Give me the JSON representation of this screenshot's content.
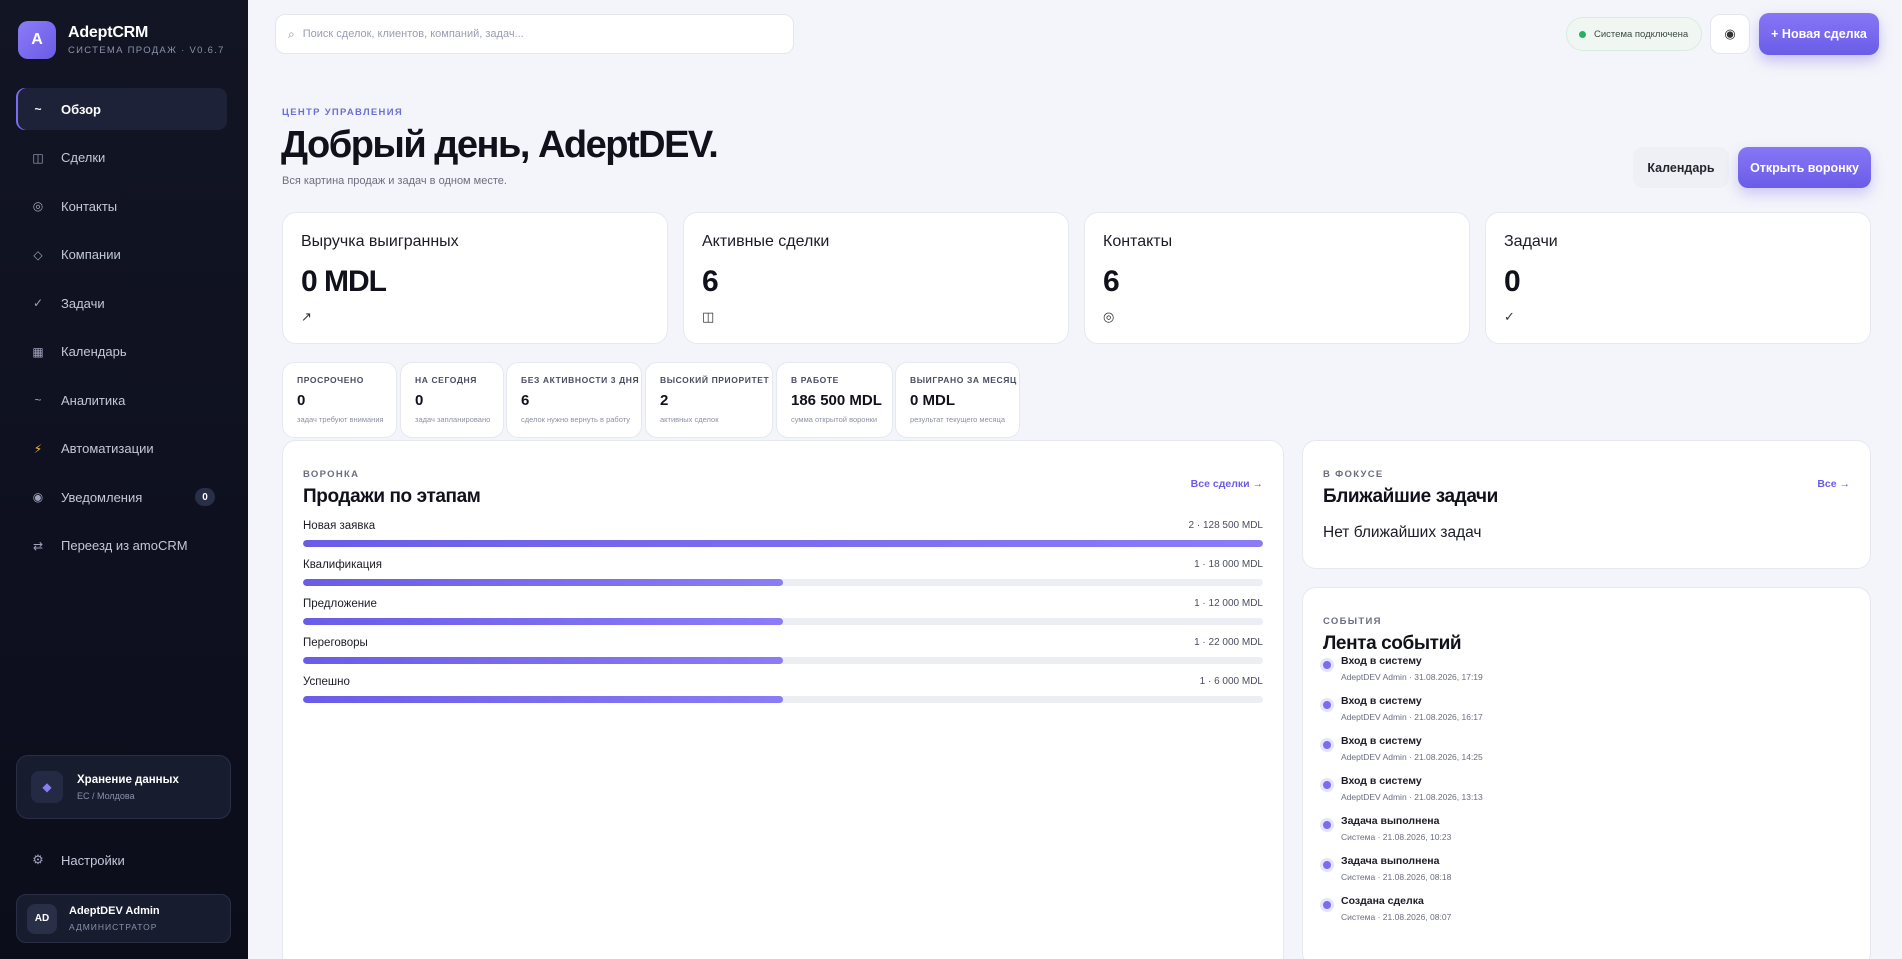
{
  "brand": {
    "logo": "A",
    "name": "AdeptCRM",
    "subtitle": "СИСТЕМА ПРОДАЖ · V0.6.7"
  },
  "nav": [
    {
      "label": "Обзор",
      "icon": "~",
      "active": true
    },
    {
      "label": "Сделки",
      "icon": "◫"
    },
    {
      "label": "Контакты",
      "icon": "◎"
    },
    {
      "label": "Компании",
      "icon": "◇"
    },
    {
      "label": "Задачи",
      "icon": "✓"
    },
    {
      "label": "Календарь",
      "icon": "▦"
    },
    {
      "label": "Аналитика",
      "icon": "~"
    },
    {
      "label": "Автоматизации",
      "icon": "⚡"
    },
    {
      "label": "Уведомления",
      "icon": "◉",
      "badge": "0"
    },
    {
      "label": "Переезд из amoCRM",
      "icon": "⇄"
    }
  ],
  "storage": {
    "icon": "◆",
    "title": "Хранение данных",
    "subtitle": "ЕС / Молдова"
  },
  "settings": {
    "icon": "⚙",
    "label": "Настройки"
  },
  "user": {
    "initials": "AD",
    "name": "AdeptDEV Admin",
    "role": "АДМИНИСТРАТОР"
  },
  "topbar": {
    "search_icon": "⌕",
    "search_placeholder": "Поиск сделок, клиентов, компаний, задач...",
    "status": "Система подключена",
    "theme_icon": "◉",
    "new_deal": "+ Новая сделка"
  },
  "header": {
    "eyebrow": "ЦЕНТР УПРАВЛЕНИЯ",
    "title": "Добрый день, AdeptDEV.",
    "subtitle": "Вся картина продаж и задач в одном месте.",
    "calendar_btn": "Календарь",
    "funnel_btn": "Открыть воронку"
  },
  "kpis": [
    {
      "label": "Выручка выигранных",
      "value": "0 MDL",
      "icon": "↗"
    },
    {
      "label": "Активные сделки",
      "value": "6",
      "icon": "◫"
    },
    {
      "label": "Контакты",
      "value": "6",
      "icon": "◎"
    },
    {
      "label": "Задачи",
      "value": "0",
      "icon": "✓"
    }
  ],
  "mini_stats": [
    {
      "label": "ПРОСРОЧЕНО",
      "value": "0",
      "sub": "задач требуют внимания"
    },
    {
      "label": "НА СЕГОДНЯ",
      "value": "0",
      "sub": "задач запланировано"
    },
    {
      "label": "БЕЗ АКТИВНОСТИ 3 ДНЯ",
      "value": "6",
      "sub": "сделок нужно вернуть в работу"
    },
    {
      "label": "ВЫСОКИЙ ПРИОРИТЕТ",
      "value": "2",
      "sub": "активных сделок"
    },
    {
      "label": "В РАБОТЕ",
      "value": "186 500 MDL",
      "sub": "сумма открытой воронки"
    },
    {
      "label": "ВЫИГРАНО ЗА МЕСЯЦ",
      "value": "0 MDL",
      "sub": "результат текущего месяца"
    }
  ],
  "funnel": {
    "eyebrow": "ВОРОНКА",
    "title": "Продажи по этапам",
    "link": "Все сделки →",
    "stages": [
      {
        "name": "Новая заявка",
        "meta": "2 · 128 500 MDL",
        "fraction": 1.0
      },
      {
        "name": "Квалификация",
        "meta": "1 · 18 000 MDL",
        "fraction": 0.5
      },
      {
        "name": "Предложение",
        "meta": "1 · 12 000 MDL",
        "fraction": 0.5
      },
      {
        "name": "Переговоры",
        "meta": "1 · 22 000 MDL",
        "fraction": 0.5
      },
      {
        "name": "Успешно",
        "meta": "1 · 6 000 MDL",
        "fraction": 0.5
      }
    ]
  },
  "tasks": {
    "eyebrow": "В ФОКУСЕ",
    "title": "Ближайшие задачи",
    "link": "Все →",
    "empty": "Нет ближайших задач"
  },
  "events": {
    "eyebrow": "СОБЫТИЯ",
    "title": "Лента событий",
    "items": [
      {
        "title": "Вход в систему",
        "meta": "AdeptDEV Admin · 31.08.2026, 17:19"
      },
      {
        "title": "Вход в систему",
        "meta": "AdeptDEV Admin · 21.08.2026, 16:17"
      },
      {
        "title": "Вход в систему",
        "meta": "AdeptDEV Admin · 21.08.2026, 14:25"
      },
      {
        "title": "Вход в систему",
        "meta": "AdeptDEV Admin · 21.08.2026, 13:13"
      },
      {
        "title": "Задача выполнена",
        "meta": "Система · 21.08.2026, 10:23"
      },
      {
        "title": "Задача выполнена",
        "meta": "Система · 21.08.2026, 08:18"
      },
      {
        "title": "Создана сделка",
        "meta": "Система · 21.08.2026, 08:07"
      }
    ]
  },
  "colors": {
    "accent": "#6b5ce8",
    "sidebar": "#0e1020",
    "status_ok": "#29b067"
  }
}
